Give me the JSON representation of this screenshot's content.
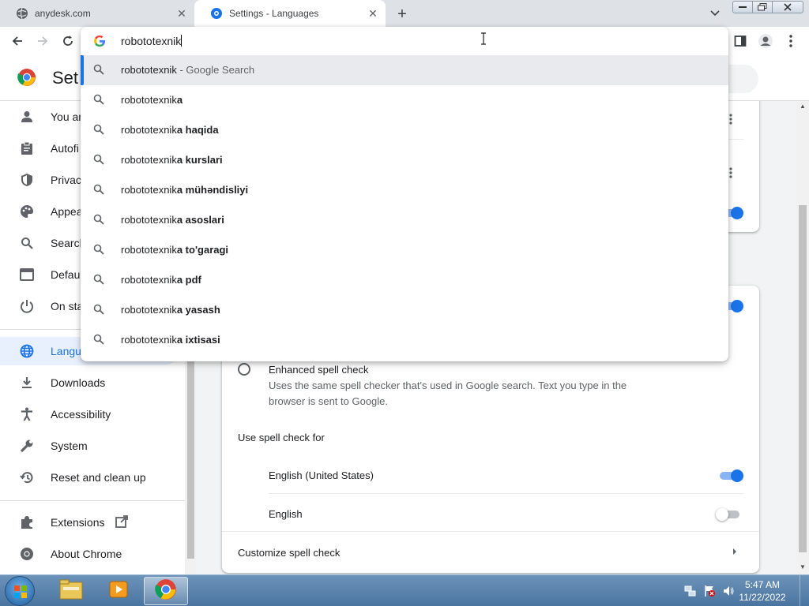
{
  "browser": {
    "tabs": [
      {
        "title": "anydesk.com",
        "icon": "globe-icon"
      },
      {
        "title": "Settings - Languages",
        "icon": "gear-icon"
      }
    ],
    "close_glyph": "✕",
    "new_tab_glyph": "+"
  },
  "omnibox": {
    "typed": "robototexnik",
    "suggestions": [
      {
        "prefix": "robototexnik",
        "bold": "",
        "suffix": " - Google Search"
      },
      {
        "prefix": "robototexnik",
        "bold": "a",
        "suffix": ""
      },
      {
        "prefix": "robototexnik",
        "bold": "a haqida",
        "suffix": ""
      },
      {
        "prefix": "robototexnik",
        "bold": "a kurslari",
        "suffix": ""
      },
      {
        "prefix": "robototexnik",
        "bold": "a mühəndisliyi",
        "suffix": ""
      },
      {
        "prefix": "robototexnik",
        "bold": "a asoslari",
        "suffix": ""
      },
      {
        "prefix": "robototexnik",
        "bold": "a to'garagi",
        "suffix": ""
      },
      {
        "prefix": "robototexnik",
        "bold": "a pdf",
        "suffix": ""
      },
      {
        "prefix": "robototexnik",
        "bold": "a yasash",
        "suffix": ""
      },
      {
        "prefix": "robototexnik",
        "bold": "a ixtisasi",
        "suffix": ""
      }
    ]
  },
  "settings": {
    "title": "Set",
    "sidebar": [
      {
        "label": "You ar",
        "icon": "person-icon"
      },
      {
        "label": "Autofi",
        "icon": "clipboard-icon"
      },
      {
        "label": "Privac",
        "icon": "shield-icon"
      },
      {
        "label": "Appea",
        "icon": "palette-icon"
      },
      {
        "label": "Search",
        "icon": "search-icon"
      },
      {
        "label": "Defau",
        "icon": "browser-icon"
      },
      {
        "label": "On sta",
        "icon": "power-icon"
      },
      {
        "label": "Langu",
        "icon": "globe-icon"
      },
      {
        "label": "Downloads",
        "icon": "download-icon"
      },
      {
        "label": "Accessibility",
        "icon": "accessibility-icon"
      },
      {
        "label": "System",
        "icon": "wrench-icon"
      },
      {
        "label": "Reset and clean up",
        "icon": "restore-icon"
      },
      {
        "label": "Extensions",
        "icon": "puzzle-icon"
      },
      {
        "label": "About Chrome",
        "icon": "chrome-icon"
      }
    ],
    "spell": {
      "enhanced_label": "Enhanced spell check",
      "enhanced_desc_1": "Uses the same spell checker that's used in Google search. Text you type in the",
      "enhanced_desc_2": "browser is sent to Google.",
      "use_for_label": "Use spell check for",
      "languages": [
        {
          "name": "English (United States)",
          "enabled": true
        },
        {
          "name": "English",
          "enabled": false
        }
      ],
      "customize_label": "Customize spell check"
    }
  },
  "taskbar": {
    "time": "5:47 AM",
    "date": "11/22/2022"
  },
  "colors": {
    "accent": "#1a73e8",
    "taskbar": "#4a74a0"
  }
}
